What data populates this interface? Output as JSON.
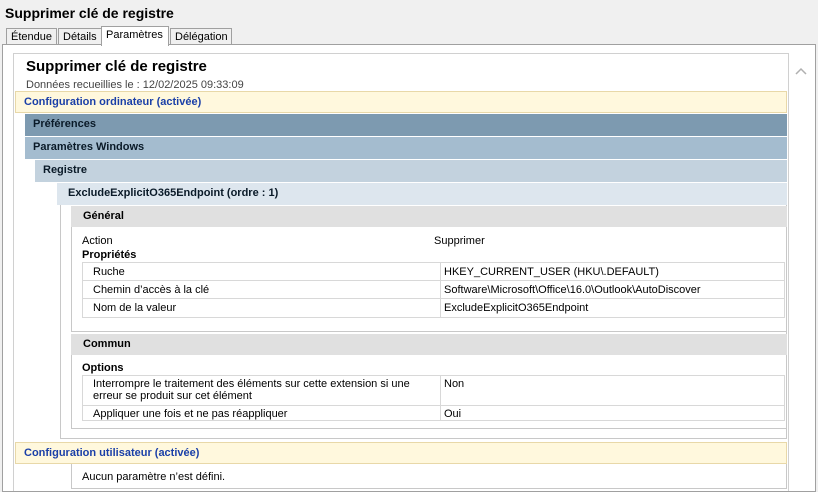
{
  "window": {
    "title": "Supprimer clé de registre"
  },
  "tabs": [
    {
      "label": "Étendue"
    },
    {
      "label": "Détails"
    },
    {
      "label": "Paramètres"
    },
    {
      "label": "Délégation"
    }
  ],
  "report": {
    "heading": "Supprimer clé de registre",
    "collected": "Données recueillies le : 12/02/2025 09:33:09",
    "computer_config": "Configuration ordinateur (activée)",
    "preferences": "Préférences",
    "windows_settings": "Paramètres Windows",
    "registry": "Registre",
    "item": "ExcludeExplicitO365Endpoint (ordre : 1)",
    "general": "Général",
    "action_label": "Action",
    "action_value": "Supprimer",
    "properties": "Propriétés",
    "props": [
      {
        "name": "Ruche",
        "value": "HKEY_CURRENT_USER (HKU\\.DEFAULT)"
      },
      {
        "name": "Chemin d’accès à la clé",
        "value": "Software\\Microsoft\\Office\\16.0\\Outlook\\AutoDiscover"
      },
      {
        "name": "Nom de la valeur",
        "value": "ExcludeExplicitO365Endpoint"
      }
    ],
    "common": "Commun",
    "options": "Options",
    "opts": [
      {
        "name": "Interrompre le traitement des éléments sur cette extension si une erreur se produit sur cet élément",
        "value": "Non"
      },
      {
        "name": "Appliquer une fois et ne pas réappliquer",
        "value": "Oui"
      }
    ],
    "user_config": "Configuration utilisateur (activée)",
    "no_settings": "Aucun paramètre n’est défini."
  }
}
